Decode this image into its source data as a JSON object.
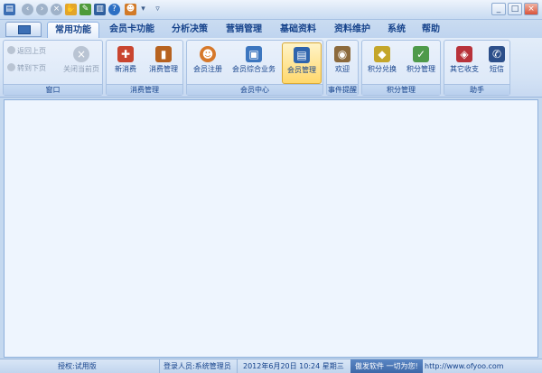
{
  "tabs": [
    "常用功能",
    "会员卡功能",
    "分析决策",
    "营销管理",
    "基础资料",
    "资料维护",
    "系统",
    "帮助"
  ],
  "window_group": {
    "label": "窗口",
    "back": "返回上页",
    "forward": "转到下页",
    "close": "关闭当前页"
  },
  "consume_group": {
    "label": "消费管理",
    "new": "新消费",
    "manage": "消费管理"
  },
  "member_group": {
    "label": "会员中心",
    "register": "会员注册",
    "combined": "会员综合业务",
    "manage": "会员管理"
  },
  "event_group": {
    "label": "事件提醒",
    "welcome": "欢迎"
  },
  "points_group": {
    "label": "积分管理",
    "exchange": "积分兑换",
    "manage": "积分管理"
  },
  "helper_group": {
    "label": "助手",
    "other": "其它收支",
    "sms": "短信"
  },
  "status": {
    "license": "授权:试用版",
    "user": "登录人员:系统管理员",
    "datetime": "2012年6月20日 10:24 星期三",
    "brand": "傲发软件 一切为您!",
    "url": "http://www.ofyoo.com"
  }
}
